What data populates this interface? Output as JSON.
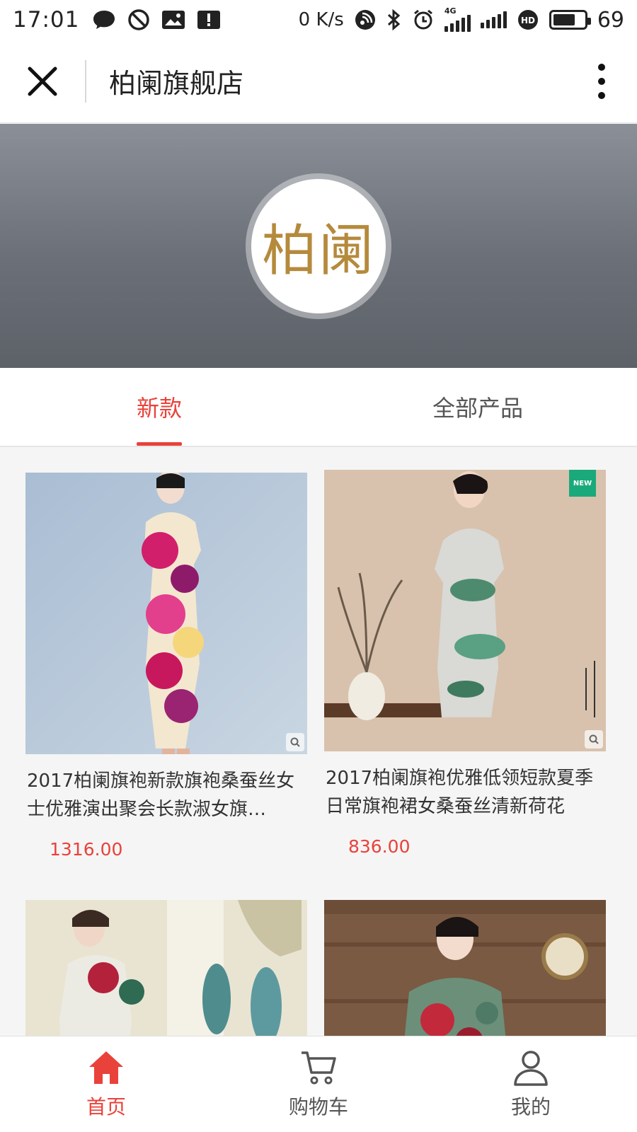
{
  "status_bar": {
    "time": "17:01",
    "net_speed": "0 K/s",
    "network_type": "4G",
    "battery": "69"
  },
  "header": {
    "title": "柏阑旗舰店"
  },
  "banner": {
    "logo_text": "柏阑"
  },
  "tabs": [
    {
      "label": "新款",
      "active": true
    },
    {
      "label": "全部产品",
      "active": false
    }
  ],
  "products": [
    {
      "title": "2017柏阑旗袍新款旗袍桑蚕丝女士优雅演出聚会长款淑女旗…",
      "price": "1316.00",
      "badge": ""
    },
    {
      "title": "2017柏阑旗袍优雅低领短款夏季日常旗袍裙女桑蚕丝清新荷花",
      "price": "836.00",
      "badge": "NEW"
    },
    {
      "title": "",
      "price": "",
      "badge": ""
    },
    {
      "title": "",
      "price": "",
      "badge": ""
    }
  ],
  "bottom_nav": [
    {
      "label": "首页",
      "icon": "home-icon",
      "active": true
    },
    {
      "label": "购物车",
      "icon": "cart-icon",
      "active": false
    },
    {
      "label": "我的",
      "icon": "user-icon",
      "active": false
    }
  ],
  "colors": {
    "accent": "#e9423a",
    "logo_gold": "#b58a3c",
    "new_badge": "#1aa97a"
  }
}
